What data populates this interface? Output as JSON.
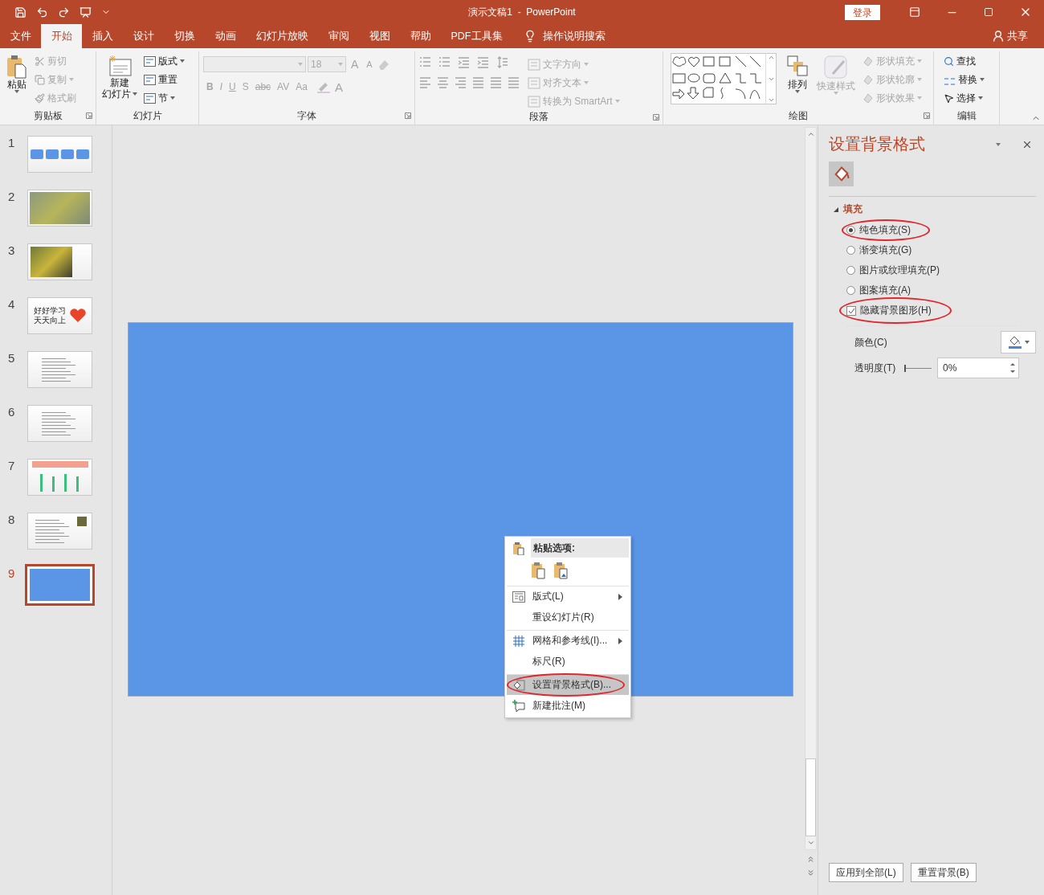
{
  "title_bar": {
    "title": "演示文稿1  -  PowerPoint",
    "sign_in": "登录"
  },
  "tabs": [
    {
      "label": "文件",
      "selected": false
    },
    {
      "label": "开始",
      "selected": true
    },
    {
      "label": "插入",
      "selected": false
    },
    {
      "label": "设计",
      "selected": false
    },
    {
      "label": "切换",
      "selected": false
    },
    {
      "label": "动画",
      "selected": false
    },
    {
      "label": "幻灯片放映",
      "selected": false
    },
    {
      "label": "审阅",
      "selected": false
    },
    {
      "label": "视图",
      "selected": false
    },
    {
      "label": "帮助",
      "selected": false
    },
    {
      "label": "PDF工具集",
      "selected": false
    }
  ],
  "tell_me": "操作说明搜索",
  "share": "共享",
  "ribbon": {
    "clipboard": {
      "label": "剪贴板",
      "paste": "粘贴",
      "items": [
        {
          "label": "剪切",
          "disabled": true
        },
        {
          "label": "复制",
          "disabled": true
        },
        {
          "label": "格式刷",
          "disabled": true
        }
      ]
    },
    "slides": {
      "label": "幻灯片",
      "new_slide": [
        "新建",
        "幻灯片"
      ],
      "items": [
        {
          "label": "版式",
          "disabled": false
        },
        {
          "label": "重置",
          "disabled": false
        },
        {
          "label": "节",
          "disabled": false
        }
      ]
    },
    "font": {
      "label": "字体",
      "size": "18",
      "disabled": true,
      "grow": "A",
      "shrink": "A",
      "glyphs": [
        "B",
        "I",
        "U",
        "S",
        "abc",
        "AV",
        "Aa"
      ],
      "font_color": "A"
    },
    "paragraph": {
      "label": "段落",
      "items": [
        {
          "label": "文字方向",
          "disabled": true
        },
        {
          "label": "对齐文本",
          "disabled": true
        },
        {
          "label": "转换为 SmartArt",
          "disabled": true
        }
      ]
    },
    "drawing": {
      "label": "绘图",
      "arrange": {
        "label": "排列",
        "disabled": false
      },
      "quick_styles": {
        "label": "快速样式",
        "disabled": true
      },
      "items": [
        {
          "label": "形状填充",
          "disabled": true
        },
        {
          "label": "形状轮廓",
          "disabled": true
        },
        {
          "label": "形状效果",
          "disabled": true
        }
      ]
    },
    "editing": {
      "label": "编辑",
      "items": [
        {
          "label": "查找",
          "disabled": false
        },
        {
          "label": "替换",
          "disabled": false
        },
        {
          "label": "选择",
          "disabled": false
        }
      ]
    }
  },
  "slides": [
    {
      "number": "1",
      "kind": "buttons",
      "selected": false
    },
    {
      "number": "2",
      "kind": "photo",
      "selected": false
    },
    {
      "number": "3",
      "kind": "photo-left",
      "selected": false
    },
    {
      "number": "4",
      "kind": "text-heart",
      "selected": false,
      "text": [
        "好好学习",
        "天天向上"
      ]
    },
    {
      "number": "5",
      "kind": "lines",
      "selected": false
    },
    {
      "number": "6",
      "kind": "lines",
      "selected": false
    },
    {
      "number": "7",
      "kind": "chart",
      "selected": false
    },
    {
      "number": "8",
      "kind": "lines-photo",
      "selected": false
    },
    {
      "number": "9",
      "kind": "blank",
      "selected": true
    }
  ],
  "context_menu": {
    "paste_header": "粘贴选项:",
    "items": [
      {
        "label": "版式(L)",
        "kind": "layout",
        "submenu": true,
        "separator_before": true,
        "highlighted": false,
        "circled": false
      },
      {
        "label": "重设幻灯片(R)",
        "kind": "none",
        "submenu": false,
        "separator_before": false,
        "highlighted": false,
        "circled": false
      },
      {
        "label": "网格和参考线(I)...",
        "kind": "grid",
        "submenu": true,
        "separator_before": true,
        "highlighted": false,
        "circled": false
      },
      {
        "label": "标尺(R)",
        "kind": "none",
        "submenu": false,
        "separator_before": false,
        "highlighted": false,
        "circled": false
      },
      {
        "label": "设置背景格式(B)...",
        "kind": "background",
        "submenu": false,
        "separator_before": true,
        "highlighted": true,
        "circled": true
      },
      {
        "label": "新建批注(M)",
        "kind": "comment",
        "submenu": false,
        "separator_before": false,
        "highlighted": false,
        "circled": false
      }
    ]
  },
  "format_pane": {
    "title": "设置背景格式",
    "section": {
      "label": "填充",
      "expanded": true
    },
    "fill_options": [
      {
        "label": "纯色填充(S)",
        "selected": true,
        "circled": true
      },
      {
        "label": "渐变填充(G)",
        "selected": false,
        "circled": false
      },
      {
        "label": "图片或纹理填充(P)",
        "selected": false,
        "circled": false
      },
      {
        "label": "图案填充(A)",
        "selected": false,
        "circled": false
      }
    ],
    "hide_background": {
      "label": "隐藏背景图形(H)",
      "checked": true,
      "circled": true
    },
    "color_label": "颜色(C)",
    "transparency": {
      "label": "透明度(T)",
      "level": 0,
      "value": "0%"
    },
    "buttons": [
      "应用到全部(L)",
      "重置背景(B)"
    ]
  }
}
